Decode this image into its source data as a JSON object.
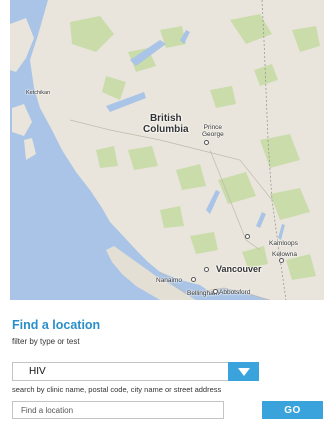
{
  "map": {
    "labels": {
      "region": "British\nColumbia",
      "prince_george": "Prince\nGeorge",
      "ketchikan": "Ketchikan",
      "kamloops": "Kamloops",
      "kelowna": "Kelowna",
      "vancouver": "Vancouver",
      "nanaimo": "Nanaimo",
      "bellingham": "Bellingham",
      "abbotsford": "Abbotsford"
    },
    "colors": {
      "water": "#a9c4e6",
      "land": "#e9e5dc",
      "parks": "#c9dcaa"
    }
  },
  "finder": {
    "title": "Find a location",
    "filter_label": "filter by type or test",
    "filter_value": "HIV",
    "search_hint": "search by clinic name, postal code, city name or street address",
    "search_placeholder": "Find a location",
    "go_label": "GO"
  },
  "colors": {
    "accent": "#3aa3dc",
    "title": "#2a8fc9"
  }
}
